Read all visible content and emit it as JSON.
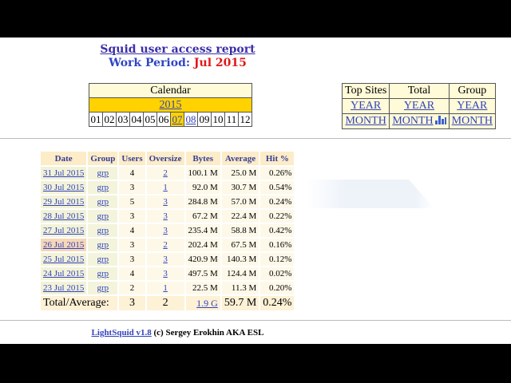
{
  "header": {
    "title": "Squid user access report",
    "period_label": "Work Period:",
    "period_value": "Jul 2015"
  },
  "calendar": {
    "title": "Calendar",
    "year": "2015",
    "months": [
      "01",
      "02",
      "03",
      "04",
      "05",
      "06",
      "07",
      "08",
      "09",
      "10",
      "11",
      "12"
    ],
    "current_month": "07",
    "linked_months": [
      "07",
      "08"
    ]
  },
  "tops": {
    "headers": [
      "Top Sites",
      "Total",
      "Group"
    ],
    "year_links": [
      "YEAR",
      "YEAR",
      "YEAR"
    ],
    "month_links": [
      "MONTH",
      "MONTH",
      "MONTH"
    ],
    "chart_icon": "bar-chart-icon"
  },
  "stats": {
    "headers": [
      "Date",
      "Group",
      "Users",
      "Oversize",
      "Bytes",
      "Average",
      "Hit %"
    ],
    "rows": [
      {
        "date": "31 Jul 2015",
        "group": "grp",
        "users": "4",
        "oversize": "2",
        "bytes": "100.1 M",
        "average": "25.0 M",
        "hit": "0.26%"
      },
      {
        "date": "30 Jul 2015",
        "group": "grp",
        "users": "3",
        "oversize": "1",
        "bytes": "92.0 M",
        "average": "30.7 M",
        "hit": "0.54%"
      },
      {
        "date": "29 Jul 2015",
        "group": "grp",
        "users": "5",
        "oversize": "3",
        "bytes": "284.8 M",
        "average": "57.0 M",
        "hit": "0.24%"
      },
      {
        "date": "28 Jul 2015",
        "group": "grp",
        "users": "3",
        "oversize": "3",
        "bytes": "67.2 M",
        "average": "22.4 M",
        "hit": "0.22%"
      },
      {
        "date": "27 Jul 2015",
        "group": "grp",
        "users": "4",
        "oversize": "3",
        "bytes": "235.4 M",
        "average": "58.8 M",
        "hit": "0.42%"
      },
      {
        "date": "26 Jul 2015",
        "group": "grp",
        "users": "3",
        "oversize": "2",
        "bytes": "202.4 M",
        "average": "67.5 M",
        "hit": "0.16%"
      },
      {
        "date": "25 Jul 2015",
        "group": "grp",
        "users": "3",
        "oversize": "3",
        "bytes": "420.9 M",
        "average": "140.3 M",
        "hit": "0.12%"
      },
      {
        "date": "24 Jul 2015",
        "group": "grp",
        "users": "4",
        "oversize": "3",
        "bytes": "497.5 M",
        "average": "124.4 M",
        "hit": "0.02%"
      },
      {
        "date": "23 Jul 2015",
        "group": "grp",
        "users": "2",
        "oversize": "1",
        "bytes": "22.5 M",
        "average": "11.3 M",
        "hit": "0.20%"
      }
    ],
    "highlight_row": 5,
    "total": {
      "label": "Total/Average:",
      "users": "3",
      "oversize": "2",
      "bytes": "1.9 G",
      "average": "59.7 M",
      "hit": "0.24%"
    }
  },
  "footer": {
    "link": "LightSquid v1.8",
    "text": "(c) Sergey Erokhin AKA ESL"
  }
}
